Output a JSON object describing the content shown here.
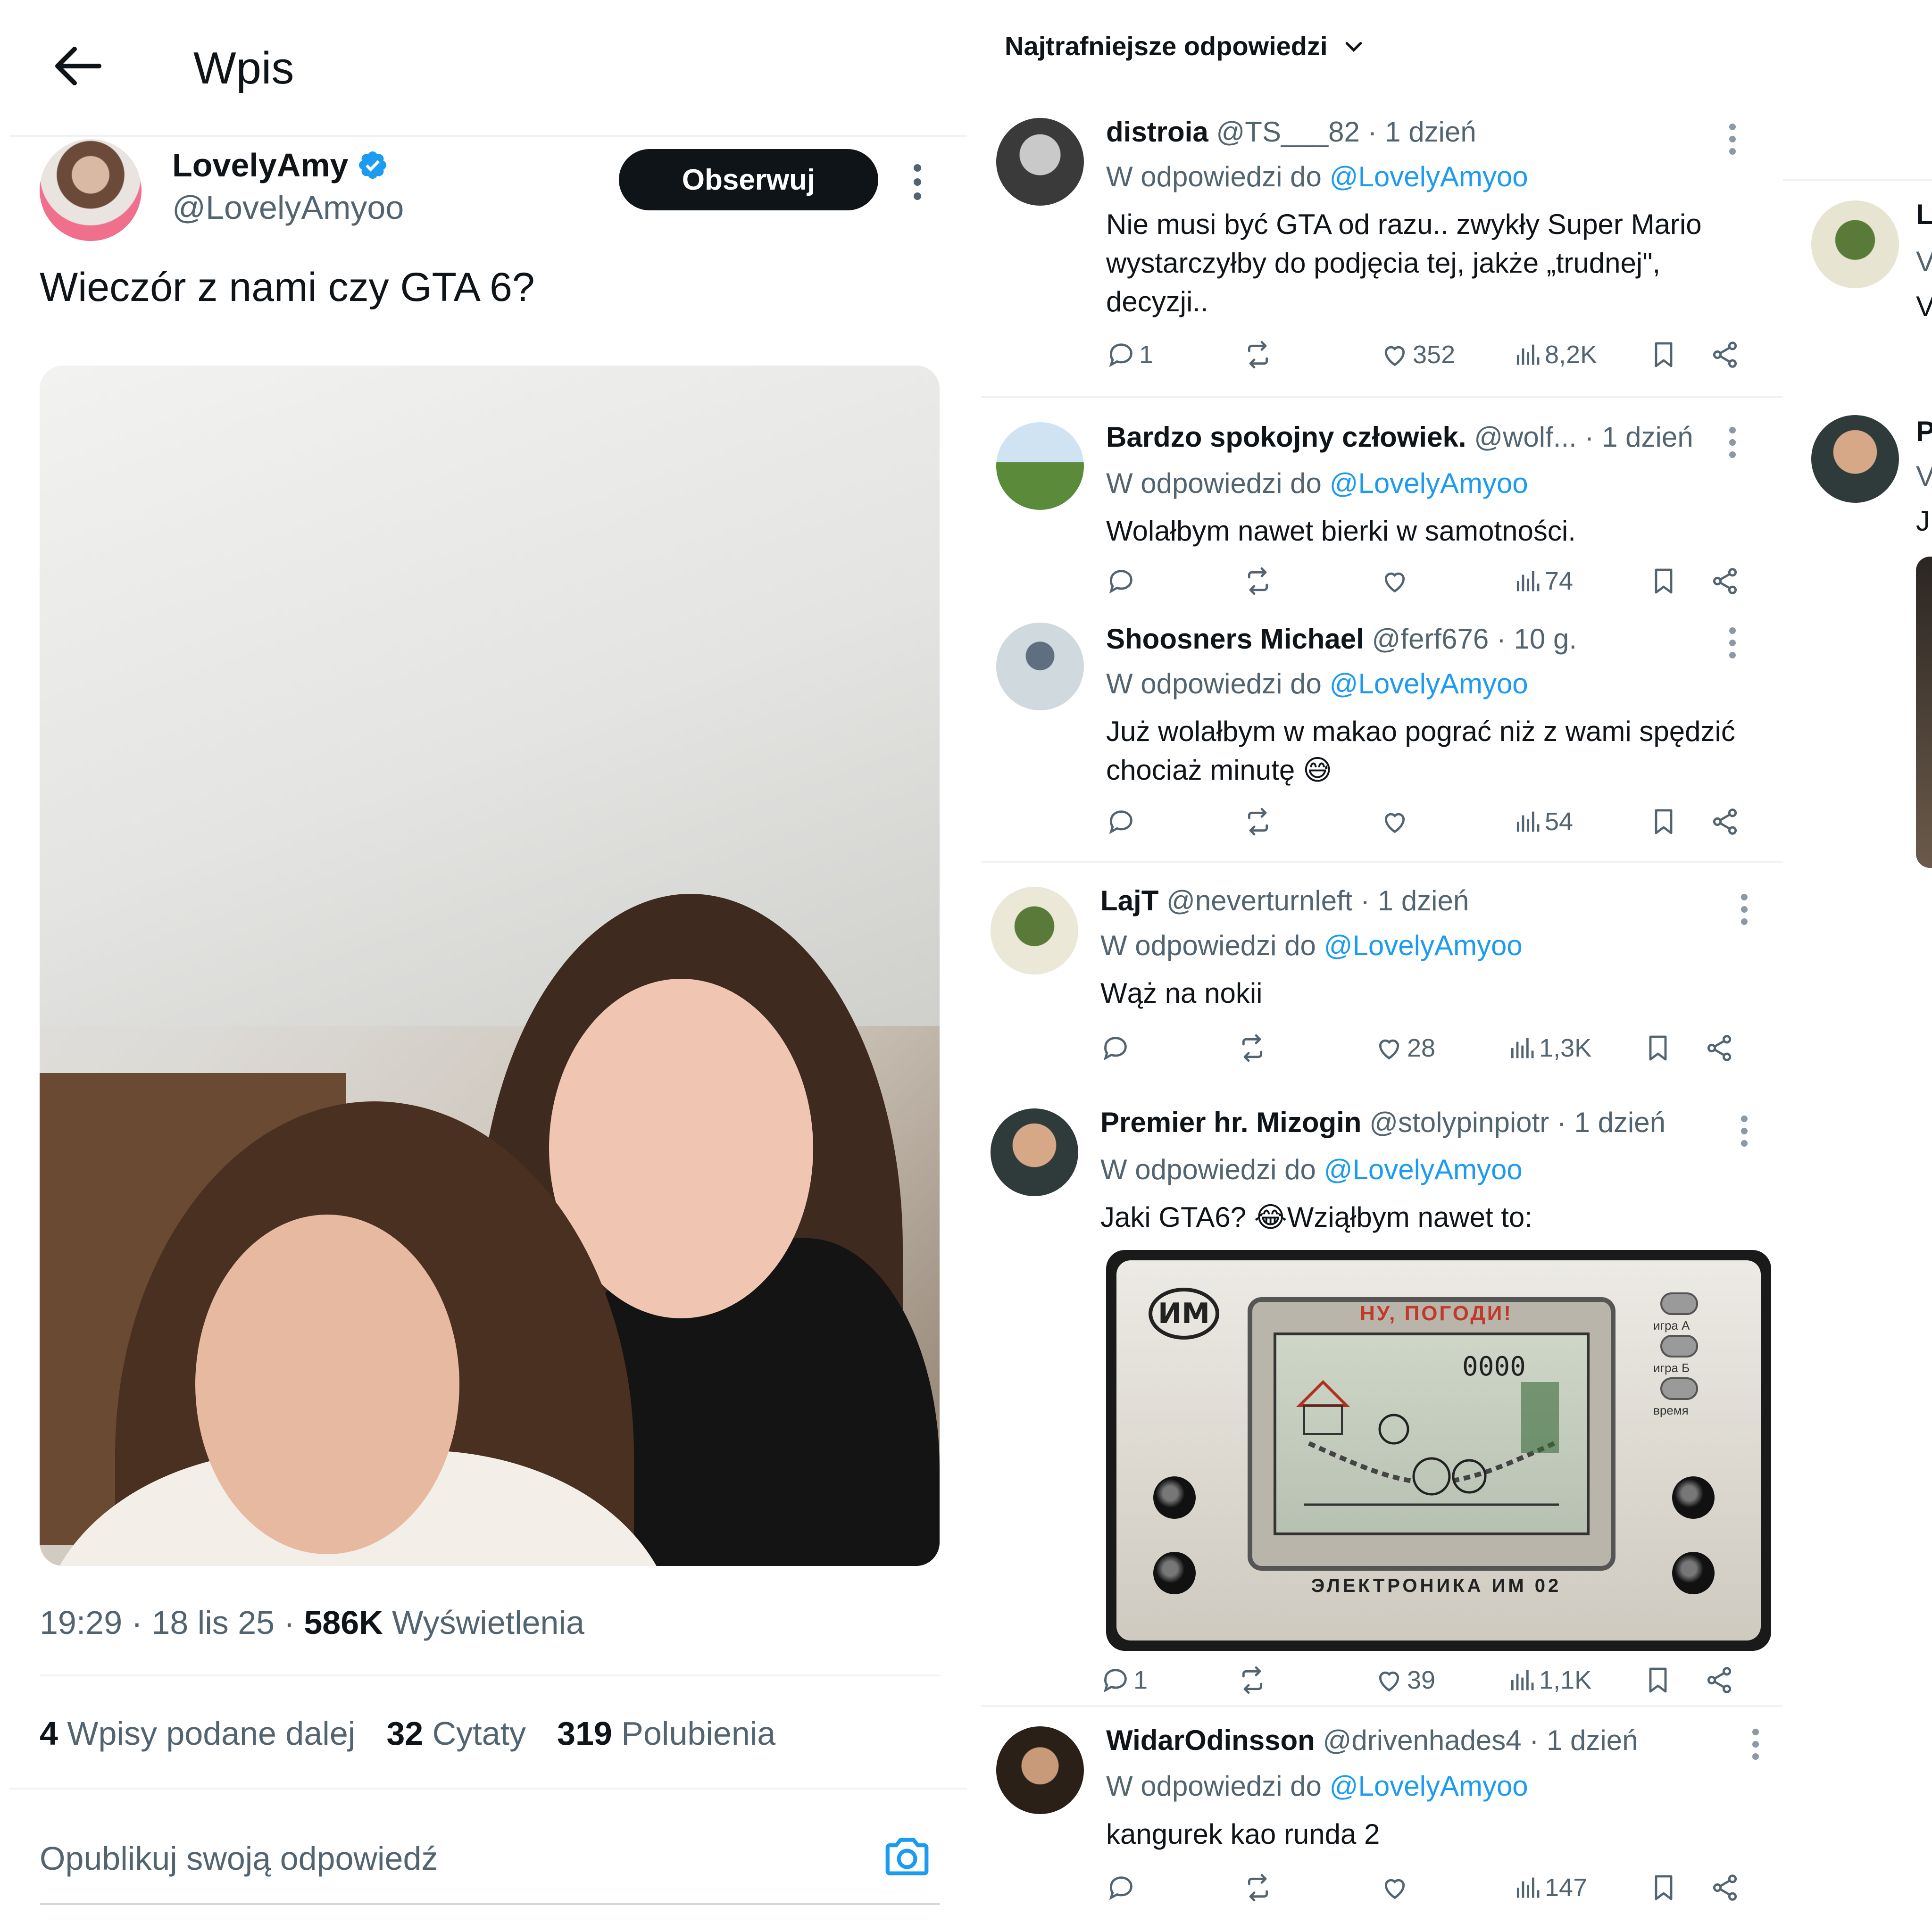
{
  "header": {
    "title": "Wpis"
  },
  "post": {
    "author_name": "LovelyAmy",
    "author_handle": "@LovelyAmyoo",
    "follow_label": "Obserwuj",
    "text": "Wieczór z nami czy GTA 6?",
    "time": "19:29",
    "date": "18 lis 25",
    "views_count": "586K",
    "views_label": "Wyświetlenia",
    "reposts_count": "4",
    "reposts_label": "Wpisy podane dalej",
    "quotes_count": "32",
    "quotes_label": "Cytaty",
    "likes_count": "319",
    "likes_label": "Polubienia",
    "reply_placeholder": "Opublikuj swoją odpowiedź"
  },
  "replies_sort": "Najtrafniejsze odpowiedzi",
  "reply_to_prefix": "W odpowiedzi do",
  "reply_to_handle": "@LovelyAmyoo",
  "replies": [
    {
      "name": "distroia",
      "handle": "@TS___82",
      "time": "· 1 dzień",
      "text": "Nie musi być GTA od razu.. zwykły Super Mario wystarczyłby do podjęcia tej, jakże „trudnej\", decyzji..",
      "replies": "1",
      "reposts": "",
      "likes": "352",
      "views": "8,2K"
    },
    {
      "name": "Bardzo spokojny człowiek.",
      "handle": "@wolf...",
      "time": "· 1 dzień",
      "text": "Wolałbym nawet bierki w samotności.",
      "replies": "",
      "reposts": "",
      "likes": "",
      "views": "74"
    },
    {
      "name": "Shoosners Michael",
      "handle": "@ferf676",
      "time": "· 10 g.",
      "text": "Już wolałbym w makao pograć niż z wami spędzić chociaż minutę 😅",
      "replies": "",
      "reposts": "",
      "likes": "",
      "views": "54"
    },
    {
      "name": "LajT",
      "handle": "@neverturnleft",
      "time": "· 1 dzień",
      "text": "Wąż na nokii",
      "replies": "",
      "reposts": "",
      "likes": "28",
      "views": "1,3K"
    },
    {
      "name": "Premier hr. Mizogin",
      "handle": "@stolypinpiotr",
      "time": "· 1 dzień",
      "text": "Jaki GTA6? 😂Wziąłbym nawet to:",
      "replies": "1",
      "reposts": "",
      "likes": "39",
      "views": "1,1K"
    },
    {
      "name": "WidarOdinsson",
      "handle": "@drivenhades4",
      "time": "· 1 dzień",
      "text": "kangurek kao runda 2",
      "replies": "",
      "reposts": "",
      "likes": "",
      "views": "147"
    }
  ],
  "game_image": {
    "logo": "ИМ",
    "title": "НУ, ПОГОДИ!",
    "bottom": "ЭЛЕКТРОНИКА ИМ 02",
    "score": "0000",
    "btn1": "игра А",
    "btn2": "игра Б",
    "btn3": "время"
  },
  "right_column": {
    "letter1": "L",
    "letter2": "V",
    "letter3": "V",
    "letter4": "P",
    "letter5": "V",
    "letter6": "J"
  },
  "colors": {
    "accent": "#1d9bf0",
    "text": "#0f1419",
    "muted": "#536471",
    "divider": "#eff3f4"
  }
}
